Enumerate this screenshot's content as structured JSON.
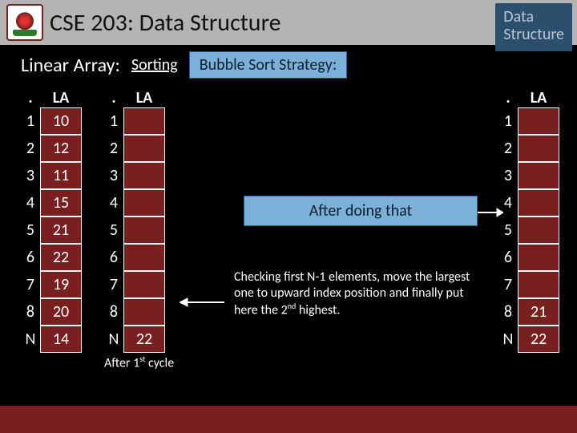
{
  "domain": "Document",
  "header": {
    "course_title": "CSE 203: Data Structure",
    "corner_line1": "Data",
    "corner_line2": "Structure"
  },
  "subhead": {
    "linear_array": "Linear Array:",
    "sorting": "Sorting",
    "badge": "Bubble Sort Strategy:"
  },
  "col_head_idx": ".",
  "col_head_val": "LA",
  "array1": {
    "rows": [
      {
        "idx": "1",
        "val": "10"
      },
      {
        "idx": "2",
        "val": "12"
      },
      {
        "idx": "3",
        "val": "11"
      },
      {
        "idx": "4",
        "val": "15"
      },
      {
        "idx": "5",
        "val": "21"
      },
      {
        "idx": "6",
        "val": "22"
      },
      {
        "idx": "7",
        "val": "19"
      },
      {
        "idx": "8",
        "val": "20"
      },
      {
        "idx": "N",
        "val": "14"
      }
    ]
  },
  "array2": {
    "rows": [
      {
        "idx": "1",
        "val": ""
      },
      {
        "idx": "2",
        "val": ""
      },
      {
        "idx": "3",
        "val": ""
      },
      {
        "idx": "4",
        "val": ""
      },
      {
        "idx": "5",
        "val": ""
      },
      {
        "idx": "6",
        "val": ""
      },
      {
        "idx": "7",
        "val": ""
      },
      {
        "idx": "8",
        "val": ""
      },
      {
        "idx": "N",
        "val": "22"
      }
    ]
  },
  "array3": {
    "rows": [
      {
        "idx": "1",
        "val": ""
      },
      {
        "idx": "2",
        "val": ""
      },
      {
        "idx": "3",
        "val": ""
      },
      {
        "idx": "4",
        "val": ""
      },
      {
        "idx": "5",
        "val": ""
      },
      {
        "idx": "6",
        "val": ""
      },
      {
        "idx": "7",
        "val": ""
      },
      {
        "idx": "8",
        "val": "21"
      },
      {
        "idx": "N",
        "val": "22"
      }
    ]
  },
  "mid_bubble": "After doing that",
  "after_label_pre": "After 1",
  "after_label_sup": "st",
  "after_label_post": " cycle",
  "note_text_1": "Checking first N-1 elements, move the largest one to upward index position and finally put here the 2",
  "note_sup": "nd",
  "note_text_2": " highest."
}
